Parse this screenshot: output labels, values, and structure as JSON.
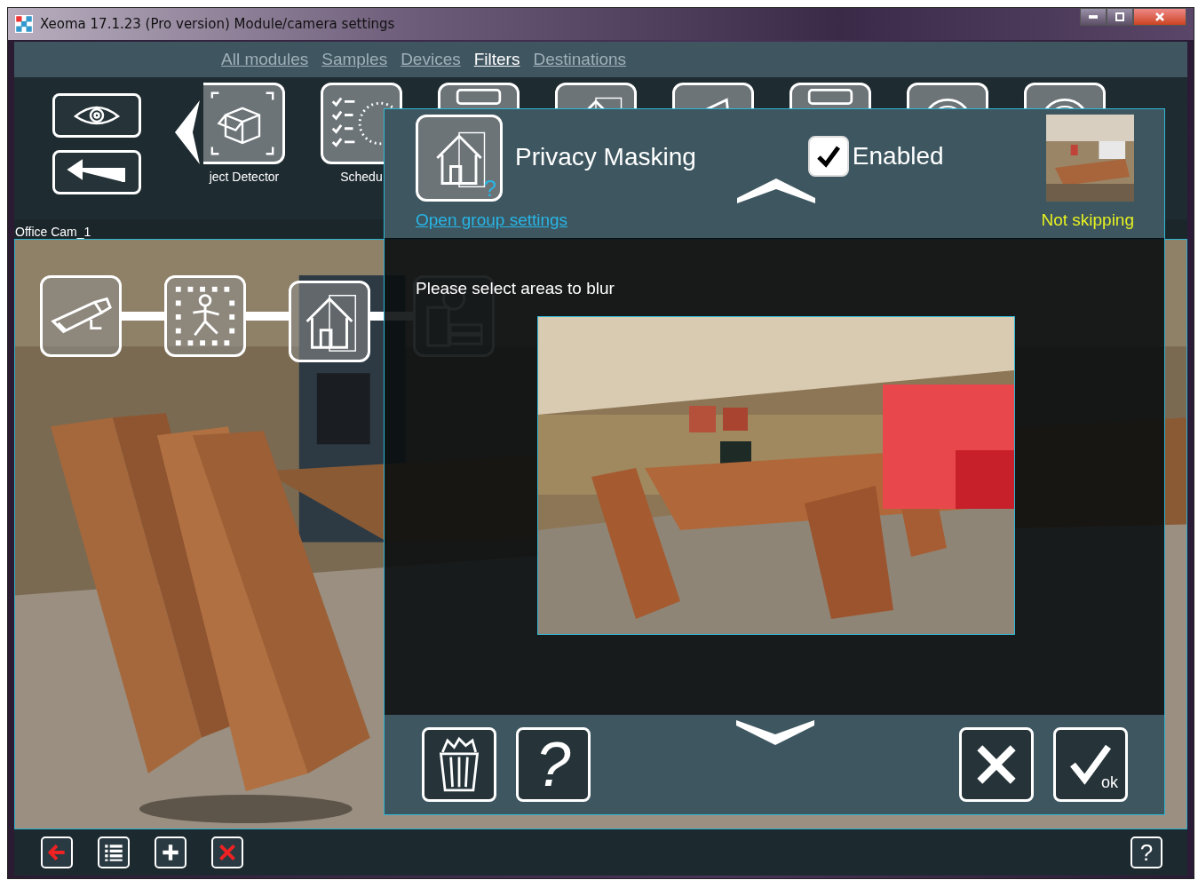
{
  "window": {
    "title": "Xeoma 17.1.23 (Pro version) Module/camera settings"
  },
  "nav_tabs": [
    {
      "label": "All modules",
      "selected": false
    },
    {
      "label": "Samples",
      "selected": false
    },
    {
      "label": "Devices",
      "selected": false
    },
    {
      "label": "Filters",
      "selected": true
    },
    {
      "label": "Destinations",
      "selected": false
    }
  ],
  "module_strip": [
    {
      "kind": "object",
      "label": "ject Detector"
    },
    {
      "kind": "schedule",
      "label": "Schedu"
    },
    {
      "kind": "screen"
    },
    {
      "kind": "privacy"
    },
    {
      "kind": "megaphone"
    },
    {
      "kind": "screen"
    },
    {
      "kind": "dial"
    },
    {
      "kind": "dial"
    }
  ],
  "camera_label": "Office Cam_1",
  "chain": [
    {
      "kind": "camera"
    },
    {
      "kind": "motion"
    },
    {
      "kind": "privacy"
    },
    {
      "kind": "archive"
    }
  ],
  "dialog": {
    "title": "Privacy Masking",
    "help_mark": "?",
    "enabled": {
      "label": "Enabled",
      "checked": true
    },
    "group_link": "Open group settings",
    "status": "Not skipping",
    "prompt": "Please select areas to blur",
    "buttons": [
      {
        "kind": "trash"
      },
      {
        "kind": "help",
        "label": "?"
      },
      {
        "kind": "cancel"
      },
      {
        "kind": "ok",
        "label": "ok"
      }
    ]
  },
  "bottom_bar": {
    "buttons": [
      {
        "kind": "back"
      },
      {
        "kind": "list"
      },
      {
        "kind": "add"
      },
      {
        "kind": "delete"
      }
    ],
    "help": "?"
  }
}
